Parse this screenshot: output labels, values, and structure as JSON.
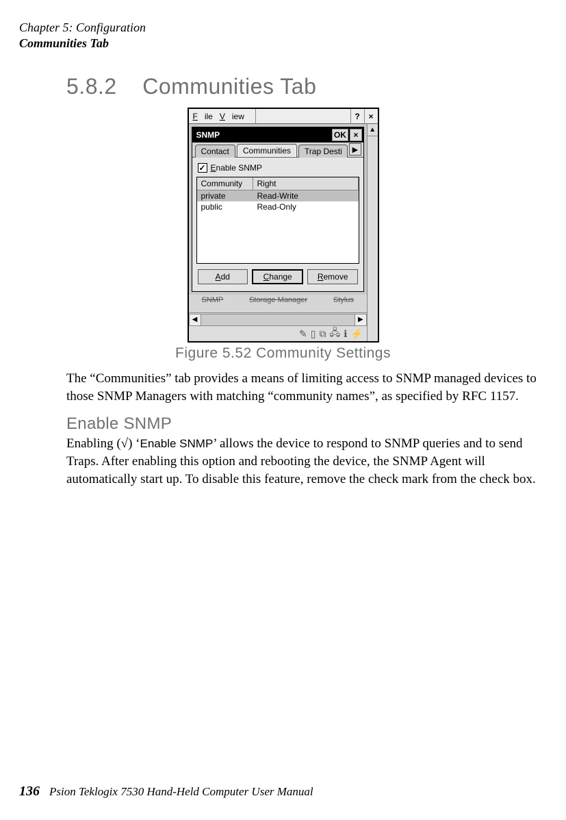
{
  "header": {
    "chapter": "Chapter 5: Configuration",
    "section_title": "Communities Tab"
  },
  "section": {
    "number": "5.8.2",
    "title": "Communities Tab"
  },
  "screenshot": {
    "topbar": {
      "file_menu": "File",
      "view_menu": "View",
      "help_symbol": "?",
      "close_symbol": "×"
    },
    "dialog": {
      "title": "SNMP",
      "ok": "OK",
      "close": "×",
      "tabs": [
        "Contact",
        "Communities",
        "Trap Desti"
      ],
      "active_tab_index": 1,
      "enable_label": "Enable SNMP",
      "checked": true,
      "columns": [
        "Community",
        "Right"
      ],
      "rows": [
        {
          "community": "private",
          "right": "Read-Write",
          "selected": true
        },
        {
          "community": "public",
          "right": "Read-Only",
          "selected": false
        }
      ],
      "buttons": {
        "add": "Add",
        "change": "Change",
        "remove": "Remove"
      }
    },
    "behind_icons": [
      "SNMP",
      "Storage Manager",
      "Stylus"
    ]
  },
  "figure_caption": "Figure 5.52 Community Settings",
  "para1": "The “Communities” tab provides a means of limiting access to SNMP managed devices to those SNMP Managers with matching “community names”, as specified by RFC 1157.",
  "subheading": "Enable SNMP",
  "para2_a": "Enabling (√) ‘",
  "para2_b": "Enable SNMP",
  "para2_c": "’ allows the device to respond to SNMP queries and to send Traps. After enabling this option and rebooting the device, the SNMP Agent will automatically start up. To disable this feature, remove the check mark from the check box.",
  "footer": {
    "page": "136",
    "text": "Psion Teklogix 7530 Hand-Held Computer User Manual"
  }
}
